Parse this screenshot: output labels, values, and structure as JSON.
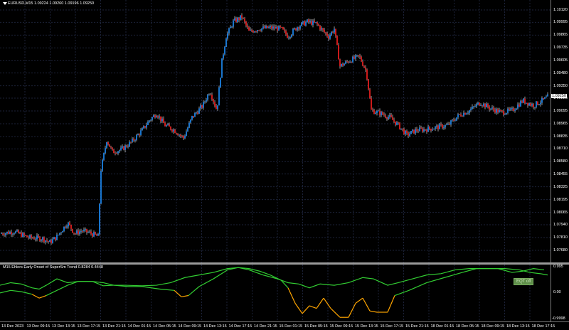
{
  "window": {
    "title": "EURUSD,M15  1.09224 1.09260 1.09196 1.09250"
  },
  "price_axis": {
    "labels": [
      "1.10120",
      "1.09995",
      "1.09865",
      "1.09735",
      "1.09605",
      "1.09480",
      "1.09350",
      "1.09225",
      "1.09095",
      "1.08965",
      "1.08835",
      "1.08710",
      "1.08580",
      "1.08455",
      "1.08325",
      "1.08195",
      "1.08065",
      "1.07940",
      "1.07810",
      "1.07680"
    ],
    "current": "1.09250"
  },
  "indicator": {
    "title": "M15 Ehlers Early Onset of SuperSm Trend 0.8284 0.4448",
    "axis_labels": [
      "0.995",
      "0.00",
      "-0.9998"
    ],
    "badge": "EQT off"
  },
  "time_axis": {
    "labels": [
      "13 Dec 2023",
      "13 Dec 09:15",
      "13 Dec 13:15",
      "13 Dec 17:15",
      "13 Dec 21:15",
      "14 Dec 01:15",
      "14 Dec 05:15",
      "14 Dec 09:15",
      "14 Dec 13:15",
      "14 Dec 17:15",
      "14 Dec 21:15",
      "15 Dec 01:15",
      "15 Dec 05:15",
      "15 Dec 09:15",
      "15 Dec 13:15",
      "15 Dec 17:15",
      "15 Dec 21:15",
      "18 Dec 01:15",
      "18 Dec 05:15",
      "18 Dec 09:15",
      "18 Dec 13:15",
      "18 Dec 17:15"
    ]
  },
  "colors": {
    "bull": "#1e90ff",
    "bear": "#ff2020",
    "wick": "#ffffff",
    "grid": "#1c2238",
    "ind_fast": "#32cd32",
    "ind_up": "#32cd32",
    "ind_down": "#ffa500"
  },
  "chart_data": {
    "type": "candlestick",
    "symbol": "EURUSD",
    "timeframe": "M15",
    "ylim": [
      1.0768,
      1.1012
    ],
    "price_path": [
      [
        0,
        1.0785
      ],
      [
        20,
        1.0787
      ],
      [
        40,
        1.0781
      ],
      [
        60,
        1.078
      ],
      [
        70,
        1.0776
      ],
      [
        80,
        1.0782
      ],
      [
        95,
        1.0796
      ],
      [
        105,
        1.0785
      ],
      [
        115,
        1.0788
      ],
      [
        125,
        1.0786
      ],
      [
        138,
        1.0782
      ],
      [
        142,
        1.085
      ],
      [
        150,
        1.088
      ],
      [
        158,
        1.0868
      ],
      [
        170,
        1.087
      ],
      [
        185,
        1.0878
      ],
      [
        200,
        1.089
      ],
      [
        210,
        1.09
      ],
      [
        220,
        1.0907
      ],
      [
        232,
        1.0895
      ],
      [
        245,
        1.089
      ],
      [
        258,
        1.0882
      ],
      [
        270,
        1.0903
      ],
      [
        285,
        1.0915
      ],
      [
        295,
        1.093
      ],
      [
        305,
        1.091
      ],
      [
        312,
        1.096
      ],
      [
        318,
        1.0985
      ],
      [
        328,
        1.1
      ],
      [
        340,
        1.1005
      ],
      [
        350,
        1.099
      ],
      [
        365,
        1.0993
      ],
      [
        380,
        1.0994
      ],
      [
        395,
        1.0993
      ],
      [
        405,
        1.0985
      ],
      [
        418,
        1.0995
      ],
      [
        432,
        1.1
      ],
      [
        445,
        1.0998
      ],
      [
        455,
        1.099
      ],
      [
        462,
        1.0985
      ],
      [
        470,
        1.0993
      ],
      [
        478,
        1.0955
      ],
      [
        490,
        1.096
      ],
      [
        505,
        1.0965
      ],
      [
        515,
        1.095
      ],
      [
        522,
        1.091
      ],
      [
        535,
        1.0907
      ],
      [
        548,
        1.0903
      ],
      [
        560,
        1.0895
      ],
      [
        572,
        1.0885
      ],
      [
        585,
        1.089
      ],
      [
        600,
        1.0891
      ],
      [
        615,
        1.0893
      ],
      [
        630,
        1.0895
      ],
      [
        645,
        1.0905
      ],
      [
        660,
        1.091
      ],
      [
        675,
        1.0918
      ],
      [
        690,
        1.0912
      ],
      [
        705,
        1.0908
      ],
      [
        720,
        1.091
      ],
      [
        735,
        1.092
      ],
      [
        750,
        1.0915
      ],
      [
        765,
        1.0921
      ],
      [
        772,
        1.0925
      ]
    ],
    "indicator": {
      "ylim": [
        -0.9998,
        0.995
      ],
      "fast": [
        [
          0,
          0.3
        ],
        [
          15,
          0.4
        ],
        [
          30,
          0.35
        ],
        [
          45,
          0.2
        ],
        [
          55,
          0.15
        ],
        [
          65,
          0.3
        ],
        [
          80,
          0.55
        ],
        [
          95,
          0.4
        ],
        [
          110,
          0.45
        ],
        [
          130,
          0.45
        ],
        [
          145,
          0.28
        ],
        [
          160,
          0.3
        ],
        [
          175,
          0.3
        ],
        [
          200,
          0.28
        ],
        [
          220,
          0.3
        ],
        [
          240,
          0.4
        ],
        [
          260,
          0.6
        ],
        [
          280,
          0.7
        ],
        [
          300,
          0.8
        ],
        [
          320,
          0.95
        ],
        [
          335,
          0.99
        ],
        [
          350,
          0.9
        ],
        [
          370,
          0.7
        ],
        [
          390,
          0.55
        ],
        [
          405,
          0.4
        ],
        [
          420,
          0.35
        ],
        [
          435,
          0.2
        ],
        [
          450,
          0.35
        ],
        [
          470,
          0.3
        ],
        [
          490,
          0.4
        ],
        [
          510,
          0.6
        ],
        [
          525,
          0.55
        ],
        [
          545,
          0.3
        ],
        [
          560,
          0.4
        ],
        [
          580,
          0.55
        ],
        [
          600,
          0.7
        ],
        [
          620,
          0.75
        ],
        [
          640,
          0.9
        ],
        [
          660,
          0.95
        ],
        [
          680,
          0.95
        ],
        [
          700,
          0.95
        ],
        [
          720,
          0.8
        ],
        [
          735,
          0.85
        ],
        [
          750,
          0.95
        ],
        [
          765,
          0.9
        ]
      ],
      "slow": [
        [
          0,
          0.0
        ],
        [
          15,
          0.1
        ],
        [
          30,
          0.05
        ],
        [
          45,
          -0.05
        ],
        [
          55,
          -0.2
        ],
        [
          65,
          -0.1
        ],
        [
          80,
          0.1
        ],
        [
          95,
          0.3
        ],
        [
          110,
          0.45
        ],
        [
          130,
          0.45
        ],
        [
          145,
          0.4
        ],
        [
          160,
          0.3
        ],
        [
          180,
          0.25
        ],
        [
          200,
          0.25
        ],
        [
          225,
          0.15
        ],
        [
          245,
          0.1
        ],
        [
          255,
          -0.15
        ],
        [
          265,
          -0.1
        ],
        [
          280,
          0.25
        ],
        [
          300,
          0.55
        ],
        [
          320,
          0.9
        ],
        [
          335,
          0.99
        ],
        [
          350,
          0.95
        ],
        [
          365,
          0.85
        ],
        [
          380,
          0.7
        ],
        [
          395,
          0.5
        ],
        [
          405,
          0.2
        ],
        [
          415,
          -0.4
        ],
        [
          425,
          -0.8
        ],
        [
          435,
          -0.5
        ],
        [
          445,
          -0.6
        ],
        [
          455,
          -0.2
        ],
        [
          465,
          -0.6
        ],
        [
          478,
          -0.95
        ],
        [
          490,
          -0.95
        ],
        [
          500,
          -0.4
        ],
        [
          510,
          -0.2
        ],
        [
          520,
          -0.7
        ],
        [
          530,
          -0.75
        ],
        [
          545,
          -0.75
        ],
        [
          555,
          -0.1
        ],
        [
          575,
          0.1
        ],
        [
          600,
          0.4
        ],
        [
          625,
          0.6
        ],
        [
          650,
          0.8
        ],
        [
          670,
          0.95
        ],
        [
          690,
          0.95
        ],
        [
          710,
          0.95
        ],
        [
          730,
          0.9
        ],
        [
          745,
          0.8
        ],
        [
          760,
          0.75
        ],
        [
          770,
          0.7
        ]
      ]
    }
  }
}
